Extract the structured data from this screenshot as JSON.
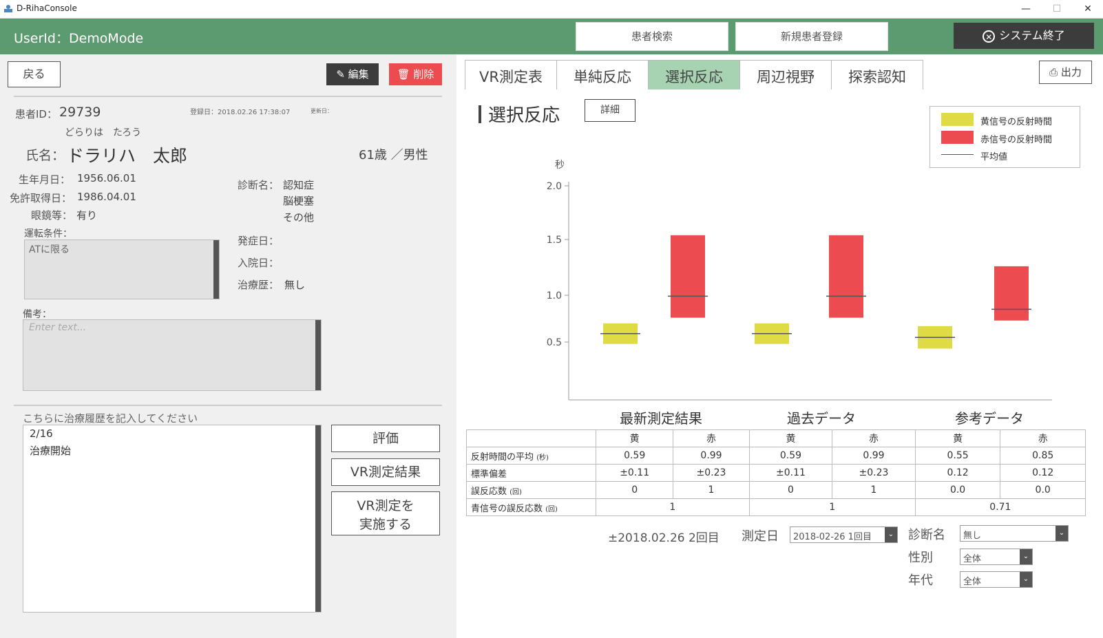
{
  "window": {
    "title": "D-RihaConsole",
    "minimize": "—",
    "maximize": "☐",
    "close": "✕"
  },
  "header": {
    "user_id": "UserId：DemoMode",
    "patient_search": "患者検索",
    "new_patient": "新規患者登録",
    "exit": "システム終了"
  },
  "left": {
    "back": "戻る",
    "edit": "編集",
    "delete": "削除",
    "patient_id_label": "患者ID：",
    "patient_id": "29739",
    "registered": "登録日：2018.02.26 17:38:07",
    "updated": "更新日：",
    "kana": "どらりは　たろう",
    "name_label": "氏名：",
    "name": "ドラリハ　太郎",
    "age_sex": "61歳 ／男性",
    "birth_label": "生年月日：",
    "birth": "1956.06.01",
    "license_label": "免許取得日：",
    "license": "1986.04.01",
    "glasses_label": "眼鏡等：",
    "glasses": "有り",
    "driving_cond_label": "運転条件：",
    "driving_cond": "ATに限る",
    "diagnosis_label": "診断名：",
    "diagnosis": [
      "認知症",
      "脳梗塞",
      "その他"
    ],
    "onset_label": "発症日：",
    "admission_label": "入院日：",
    "treatment_label": "治療歴：",
    "treatment": "無し",
    "notes_label": "備考：",
    "notes_placeholder": "Enter text...",
    "history_label": "こちらに治療履歴を記入してください",
    "history_line1": "2/16",
    "history_line2": "治療開始",
    "evaluate": "評価",
    "vr_result": "VR測定結果",
    "vr_run_1": "VR測定を",
    "vr_run_2": "実施する"
  },
  "right": {
    "tabs": [
      "VR測定表",
      "単純反応",
      "選択反応",
      "周辺視野",
      "探索認知"
    ],
    "active_tab": 2,
    "print": "出力",
    "section_title": "選択反応",
    "detail": "詳細",
    "legend": {
      "yellow": "黄信号の反射時間",
      "red": "赤信号の反射時間",
      "avg": "平均値"
    },
    "group_titles": [
      "最新測定結果",
      "過去データ",
      "参考データ"
    ],
    "table": {
      "headers": [
        "黄",
        "赤",
        "黄",
        "赤",
        "黄",
        "赤"
      ],
      "rows": [
        {
          "label": "反射時間の平均",
          "unit": "(秒)",
          "values": [
            "0.59",
            "0.99",
            "0.59",
            "0.99",
            "0.55",
            "0.85"
          ]
        },
        {
          "label": "標準偏差",
          "unit": "",
          "values": [
            "±0.11",
            "±0.23",
            "±0.11",
            "±0.23",
            "0.12",
            "0.12"
          ]
        },
        {
          "label": "誤反応数",
          "unit": "(回)",
          "values": [
            "0",
            "1",
            "0",
            "1",
            "0.0",
            "0.0"
          ]
        }
      ],
      "blue_label": "青信号の誤反応数",
      "blue_unit": "(回)",
      "blue_values": [
        "1",
        "1",
        "0.71"
      ]
    },
    "measure_info": "±2018.02.26 2回目",
    "measure_date_label": "測定日",
    "measure_date_value": "2018-02-26 1回目",
    "diag_label": "診断名",
    "diag_value": "無し",
    "sex_label": "性別",
    "sex_value": "全体",
    "age_label": "年代",
    "age_value": "全体"
  },
  "chart_data": {
    "type": "bar",
    "ylabel": "秒",
    "yticks": [
      "2.0",
      "1.5",
      "1.0",
      "0.5"
    ],
    "ylim": [
      0.0,
      2.0
    ],
    "groups": [
      "最新測定結果",
      "過去データ",
      "参考データ"
    ],
    "series": [
      {
        "name": "黄信号の反射時間",
        "color": "#dedb45",
        "low": [
          0.48,
          0.48,
          0.43
        ],
        "high": [
          0.7,
          0.7,
          0.67
        ],
        "mean": [
          0.59,
          0.59,
          0.55
        ]
      },
      {
        "name": "赤信号の反射時間",
        "color": "#ec4b4f",
        "low": [
          0.76,
          0.76,
          0.73
        ],
        "high": [
          1.54,
          1.54,
          1.26
        ],
        "mean": [
          0.99,
          0.99,
          0.85
        ]
      }
    ],
    "legend_position": "top-right"
  }
}
